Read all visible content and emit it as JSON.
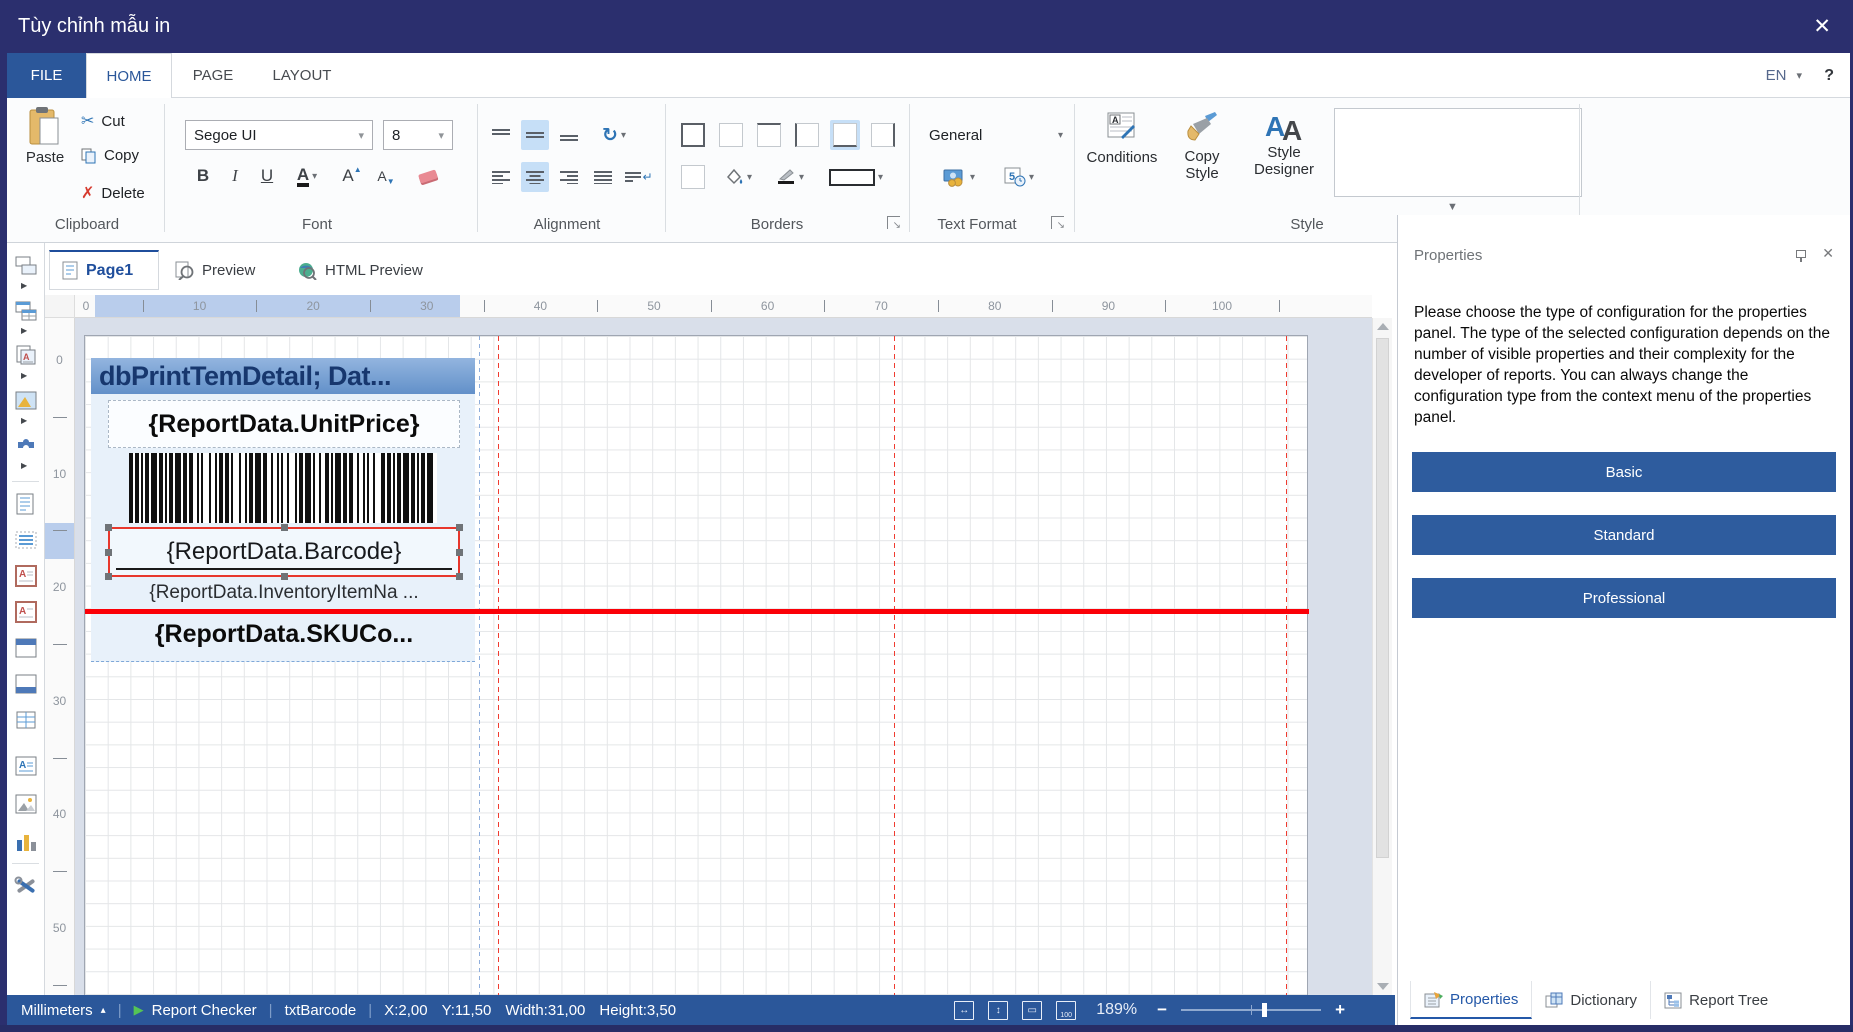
{
  "window": {
    "title": "Tùy chỉnh mẫu in",
    "close": "✕"
  },
  "tabs": {
    "file": "FILE",
    "home": "HOME",
    "page": "PAGE",
    "layout": "LAYOUT",
    "language": "EN",
    "help": "?"
  },
  "ribbon": {
    "clipboard": {
      "label": "Clipboard",
      "paste": "Paste",
      "cut": "Cut",
      "copy": "Copy",
      "delete": "Delete"
    },
    "font": {
      "label": "Font",
      "family": "Segoe UI",
      "size": "8",
      "bold": "B",
      "italic": "I",
      "underline": "U",
      "color": "A",
      "grow": "A",
      "shrink": "A"
    },
    "alignment": {
      "label": "Alignment"
    },
    "borders": {
      "label": "Borders"
    },
    "text_format": {
      "label": "Text Format",
      "value": "General"
    },
    "style": {
      "label": "Style",
      "conditions": "Conditions",
      "copy_style": "Copy Style",
      "style_designer": "Style Designer"
    }
  },
  "doc_tabs": [
    {
      "label": "Page1"
    },
    {
      "label": "Preview"
    },
    {
      "label": "HTML Preview"
    }
  ],
  "h_ruler": {
    "labels": [
      "0",
      "10",
      "20",
      "30",
      "40",
      "50",
      "60",
      "70",
      "80",
      "90",
      "100"
    ]
  },
  "v_ruler": {
    "labels": [
      "0",
      "10",
      "20",
      "30",
      "40",
      "50"
    ]
  },
  "canvas": {
    "band_header": "dbPrintTemDetail; Dat...",
    "unit_price": "{ReportData.UnitPrice}",
    "barcode_label": "{ReportData.Barcode}",
    "inventory_name": "{ReportData.InventoryItemNa ...",
    "sku_code": "{ReportData.SKUCo...",
    "barcode_pattern": "2121112131211121312122111312112121131211213122121112131121311212211131212212111213"
  },
  "properties_panel": {
    "title": "Properties",
    "description": "Please choose the type of configuration for the properties panel. The type of the selected configuration depends on the number of visible properties and their complexity for the developer of reports. You can always change the configuration type from the context menu of the properties panel.",
    "buttons": [
      {
        "label": "Basic"
      },
      {
        "label": "Standard"
      },
      {
        "label": "Professional"
      }
    ]
  },
  "panel_tabs": [
    {
      "label": "Properties"
    },
    {
      "label": "Dictionary"
    },
    {
      "label": "Report Tree"
    }
  ],
  "status_bar": {
    "units": "Millimeters",
    "checker": "Report Checker",
    "component": "txtBarcode",
    "pos_x": "X:2,00",
    "pos_y": "Y:11,50",
    "pos_w": "Width:31,00",
    "pos_h": "Height:3,50",
    "zoom": "189%"
  },
  "glyphs": {
    "cut": "✂",
    "delete": "✗",
    "rotate": "↻",
    "dropdown": "▾",
    "gallery_arrow": "▼",
    "play": "▶",
    "units_arrow": "▴",
    "launcher": "↘",
    "minus": "−",
    "plus": "+",
    "fit_width": "↔",
    "fit_height": "↕",
    "fit_page": "▭",
    "zoom_100": "100",
    "wrap": "↵"
  },
  "colors": {
    "accent": "#2B579A",
    "titlebar": "#2B2F6E",
    "selection": "#E8372C",
    "guide": "#FF1111",
    "highlight": "#C6DFF7"
  }
}
